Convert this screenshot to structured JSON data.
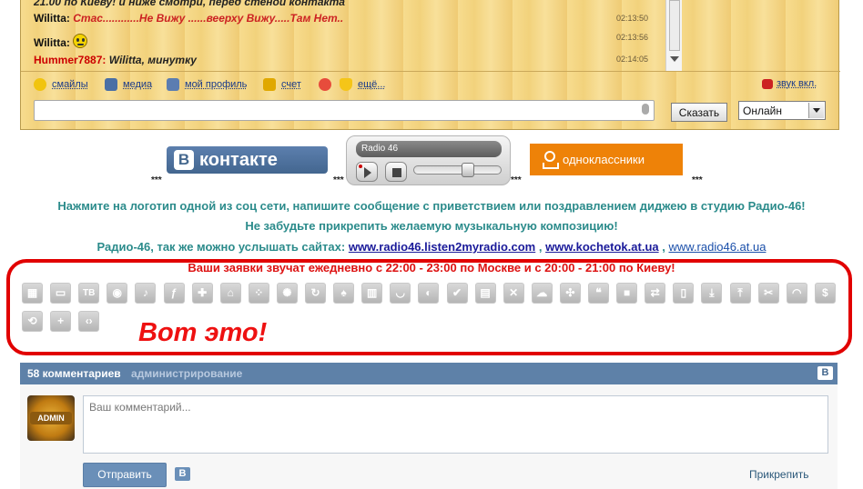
{
  "chat": {
    "top_cut_text": "21.00 по Киеву! и ниже смотри, перед стеной контакта",
    "messages": [
      {
        "nick": "Wilitta:",
        "text": "Стас............Не Вижу ......веерху Вижу.....Там Нет..",
        "time": "02:13:50"
      },
      {
        "nick": "Wilitta:",
        "text": "",
        "time": "02:13:56",
        "smiley": "smiley-icon"
      },
      {
        "nick": "Hummer7887:",
        "text": "Wilitta, минутку",
        "time": "02:14:05"
      }
    ],
    "tools": [
      {
        "label": "смайлы",
        "icon": "smiley-icon",
        "color": "#f1c40f"
      },
      {
        "label": "медиа",
        "icon": "film-icon",
        "color": "#4a6fa5"
      },
      {
        "label": "мой профиль",
        "icon": "profile-card-icon",
        "color": "#5b7db1"
      },
      {
        "label": "счет",
        "icon": "coins-icon",
        "color": "#e0a800"
      },
      {
        "label": "",
        "icon": "vip-icon",
        "color": "#e74c3c"
      },
      {
        "label": "ещё...",
        "icon": "shield-icon",
        "color": "#f5c518"
      }
    ],
    "sound_label": "звук вкл.",
    "input_value": "",
    "say_label": "Сказать",
    "status_value": "Онлайн"
  },
  "logos": {
    "vk_text": "контакте",
    "vk_letter": "В",
    "radio_name": "Radio 46",
    "ok_text": "одноклассники",
    "stars": "***"
  },
  "info": {
    "line1": "Нажмите на логотип одной из соц сети, напишите сообщение с приветствием или поздравлением диджею в студию Радио-46!",
    "line2": "Не забудьте прикрепить желаемую музыкальную композицию!",
    "line3_prefix": "Радио-46, так же можно услышать сайтах:",
    "link1": "www.radio46.listen2myradio.com",
    "link2": "www.kochetok.at.ua",
    "link3": "www.radio46.at.ua",
    "comma": ",",
    "line4": "Ваши заявки звучат ежедневно с 22:00 - 23:00 по Москве и с 20:00 - 21:00 по Киеву!"
  },
  "toolbar": {
    "icons": [
      "film-icon",
      "tv-frame-icon",
      "tv-text-icon",
      "radio-waves-icon",
      "music-note-icon",
      "flash-icon",
      "gamepad-icon",
      "home-icon",
      "dice-icon",
      "crab-icon",
      "refresh-box-icon",
      "spade-icon",
      "book-icon",
      "smile-icon",
      "yin-yang-icon",
      "check-icon",
      "calendar-icon",
      "satellite-icon",
      "weather-icon",
      "compass-icon",
      "chat-bubbles-icon",
      "video-camera-icon",
      "swap-icon",
      "document-icon",
      "download-icon",
      "upload-icon",
      "scissors-icon",
      "gauge-icon",
      "dollar-icon",
      "search-refresh-icon",
      "plus-icon",
      "code-icon"
    ],
    "tv_label": "ТВ",
    "annotation": "Вот это!"
  },
  "comments": {
    "count_label": "58 комментариев",
    "admin_label": "администрирование",
    "avatar_label": "ADMIN",
    "placeholder": "Ваш комментарий...",
    "send_label": "Отправить",
    "attach_label": "Прикрепить",
    "vk_letter": "B"
  }
}
